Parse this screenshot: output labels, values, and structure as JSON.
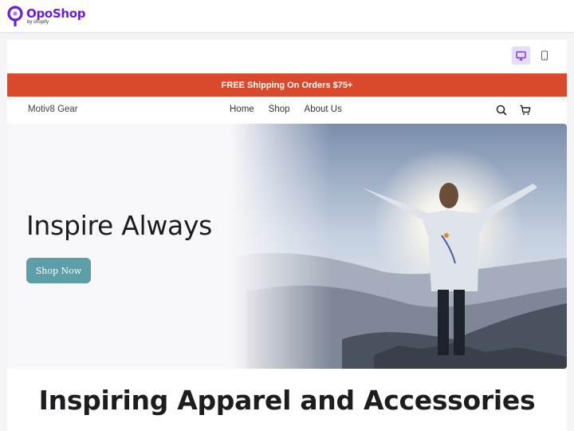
{
  "app": {
    "logo_name": "OpoShop",
    "logo_tagline": "by shopify",
    "brand_color": "#6a1fd0"
  },
  "editor": {
    "device_toggle": [
      {
        "icon": "desktop-icon",
        "active": true
      },
      {
        "icon": "mobile-icon",
        "active": false
      }
    ]
  },
  "store": {
    "announcement": "FREE Shipping On Orders $75+",
    "announcement_color": "#d9492c",
    "brand": "Motiv8 Gear",
    "nav": [
      "Home",
      "Shop",
      "About Us"
    ],
    "nav_icons": [
      "search-icon",
      "cart-icon"
    ],
    "hero": {
      "title": "Inspire Always",
      "cta": "Shop Now",
      "cta_color": "#5e9ea8",
      "image": "woman-on-mountain-peak-at-sunrise"
    },
    "section_title": "Inspiring Apparel and Accessories"
  }
}
